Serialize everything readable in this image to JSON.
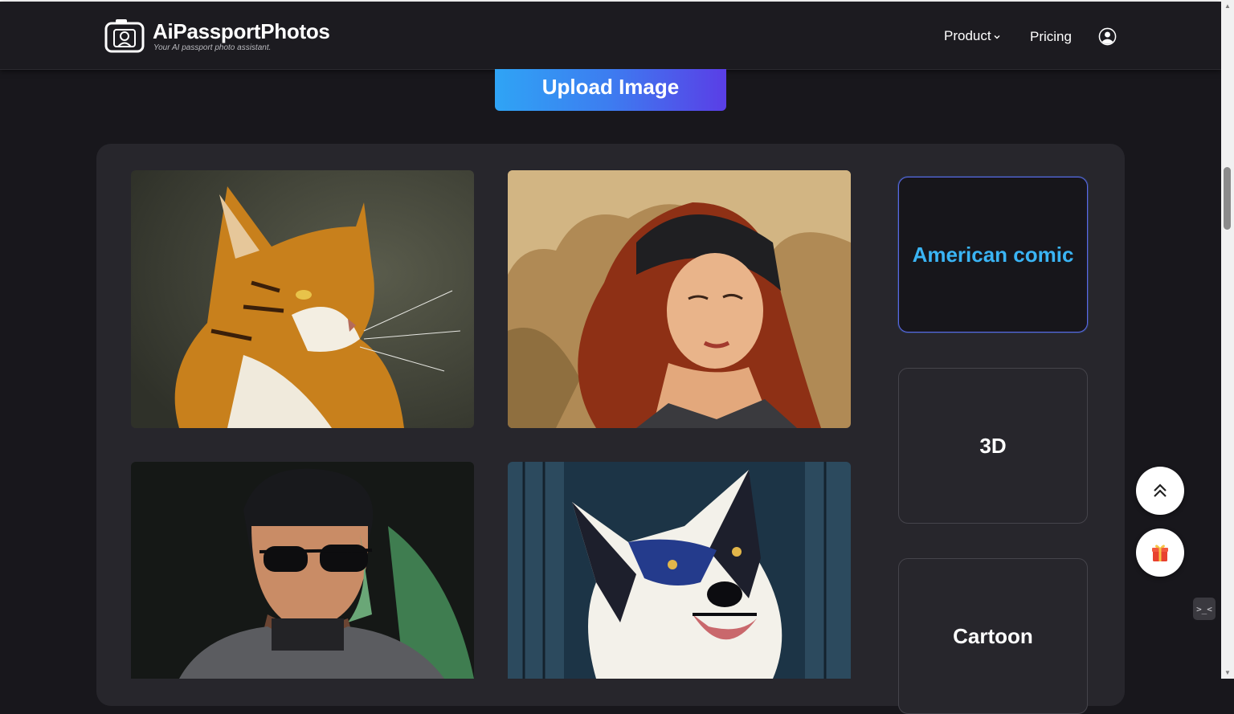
{
  "header": {
    "brand_title": "AiPassportPhotos",
    "brand_subtitle": "Your AI passport photo assistant.",
    "nav": {
      "product_label": "Product",
      "pricing_label": "Pricing"
    }
  },
  "upload": {
    "button_label": "Upload Image"
  },
  "gallery": {
    "images": [
      {
        "subject": "tiger-cat portrait"
      },
      {
        "subject": "woman in beanie comic portrait"
      },
      {
        "subject": "man with sunglasses portrait"
      },
      {
        "subject": "border collie comic portrait"
      }
    ]
  },
  "styles": {
    "items": [
      {
        "label": "American comic",
        "active": true
      },
      {
        "label": "3D",
        "active": false
      },
      {
        "label": "Cartoon",
        "active": false
      }
    ]
  },
  "floating": {
    "scroll_top_icon": "double-chevron-up-icon",
    "gift_icon": "gift-icon",
    "mini_widget_text": ">_<"
  },
  "colors": {
    "accent_gradient_start": "#2fa4f5",
    "accent_gradient_end": "#5a3ee6",
    "active_text": "#3ab4f4",
    "background": "#18171c",
    "panel": "#27262c"
  }
}
